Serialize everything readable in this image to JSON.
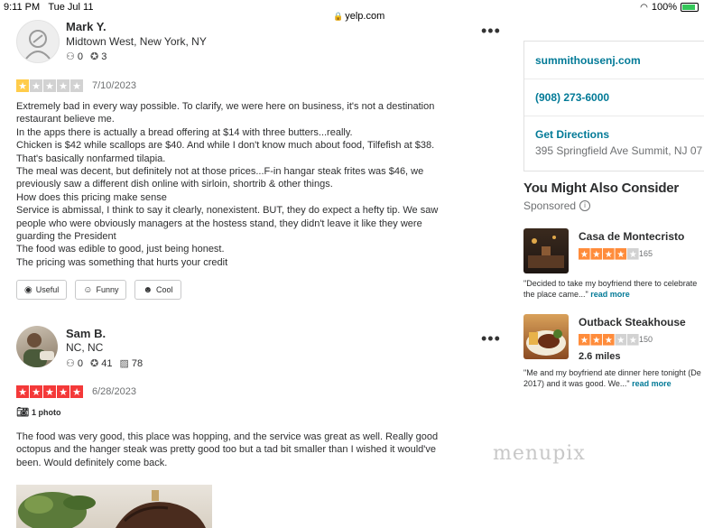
{
  "status_bar": {
    "time": "9:11 PM",
    "date": "Tue Jul 11",
    "url": "yelp.com",
    "battery": "100%"
  },
  "colors": {
    "yelp_red": "#f43939",
    "star_gray": "#d2d2d2",
    "star_yellow": "#ffcc4b",
    "star_orange": "#ff8c3b",
    "link_teal": "#027a97"
  },
  "reviews": [
    {
      "name": "Mark Y.",
      "location": "Midtown West, New York, NY",
      "friends": "0",
      "reviews_count": "3",
      "rating": 1,
      "date": "7/10/2023",
      "text": "Extremely bad in every way possible.  To clarify, we were here on business, it's not a destination\nrestaurant believe me.\nIn the apps there is actually a bread offering at $14 with three butters...really.\nChicken is $42 while scallops are $40. And while I don't know much about food, Tilfefish at $38.\nThat's basically nonfarmed  tilapia.\nThe meal was decent, but definitely not at those prices...F-in hangar steak frites  was $46, we\npreviously saw a different dish online with sirloin, shortrib & other things.\nHow does this pricing make sense\nService is abmissal, I think to say it clearly, nonexistent.  BUT, they do expect a hefty tip. We saw\npeople who were obviously managers at the hostess stand, they didn't leave it like they were\nguarding the President\nThe food was edible to good, just being honest.\nThe pricing was something that hurts your credit",
      "reactions": [
        "Useful",
        "Funny",
        "Cool"
      ]
    },
    {
      "name": "Sam B.",
      "location": "NC, NC",
      "friends": "0",
      "reviews_count": "41",
      "photos_count": "78",
      "rating": 5,
      "date": "6/28/2023",
      "photo_label": "1 photo",
      "text": "The food was very good, this place was hopping, and the service was great as well. Really good\noctopus and the hanger steak was pretty good too but a tad bit smaller than I wished it would've\nbeen. Would definitely come back."
    }
  ],
  "sidebar": {
    "website": "summithousenj.com",
    "phone": "(908) 273-6000",
    "directions_label": "Get Directions",
    "address": "395 Springfield Ave Summit, NJ 07",
    "consider_title": "You Might Also Consider",
    "sponsored": "Sponsored",
    "businesses": [
      {
        "name": "Casa de Montecristo",
        "rating": 4,
        "review_count": "165",
        "quote": "\"Decided to take my boyfriend there to celebrate\nthe place came...\"",
        "read_more": "read more"
      },
      {
        "name": "Outback Steakhouse",
        "rating": 3,
        "review_count": "150",
        "distance": "2.6 miles",
        "quote": "\"Me and my boyfriend ate dinner here tonight (De\n2017) and it was good. We...\"",
        "read_more": "read more"
      }
    ]
  },
  "watermark": "menupix"
}
